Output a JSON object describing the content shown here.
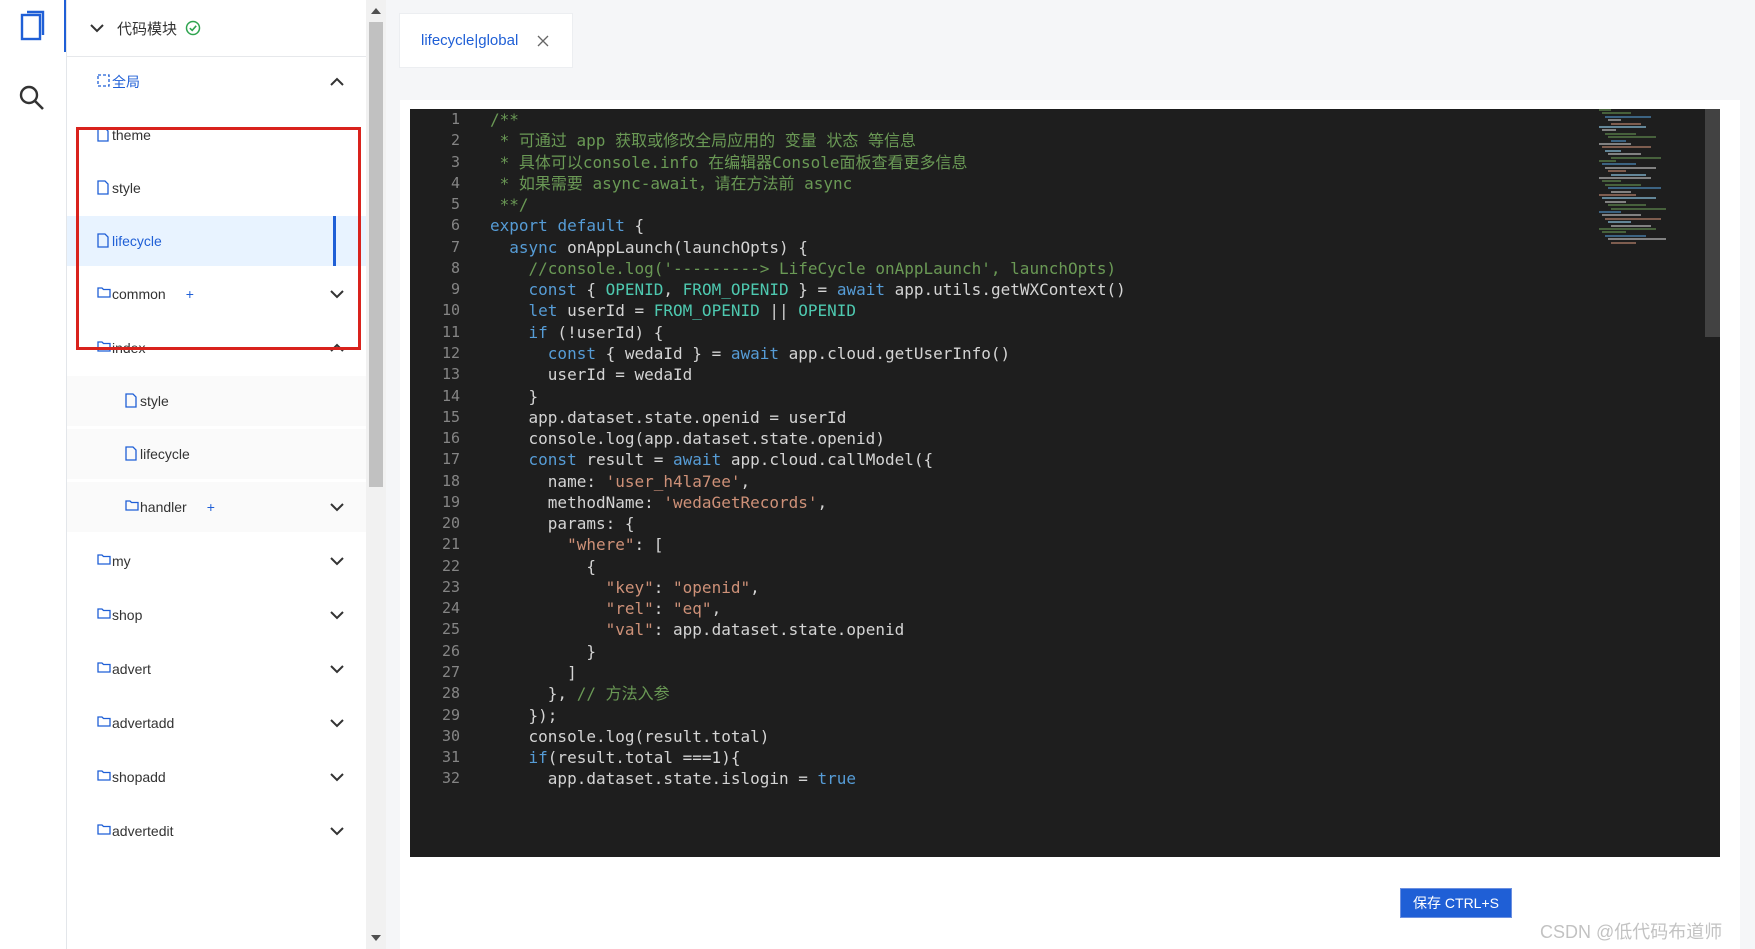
{
  "activity": {
    "icons": [
      "files-icon",
      "search-icon"
    ]
  },
  "sidebar": {
    "header_title": "代码模块",
    "items": [
      {
        "label": "全局",
        "kind": "global",
        "expanded": true
      },
      {
        "label": "theme",
        "kind": "file"
      },
      {
        "label": "style",
        "kind": "file"
      },
      {
        "label": "lifecycle",
        "kind": "file",
        "selected": true
      },
      {
        "label": "common",
        "kind": "folder",
        "plus": "+"
      },
      {
        "label": "index",
        "kind": "folder",
        "expanded": true
      },
      {
        "label": "style",
        "kind": "file"
      },
      {
        "label": "lifecycle",
        "kind": "file"
      },
      {
        "label": "handler",
        "kind": "folder",
        "plus": "+"
      },
      {
        "label": "my",
        "kind": "folder"
      },
      {
        "label": "shop",
        "kind": "folder"
      },
      {
        "label": "advert",
        "kind": "folder"
      },
      {
        "label": "advertadd",
        "kind": "folder"
      },
      {
        "label": "shopadd",
        "kind": "folder"
      },
      {
        "label": "advertedit",
        "kind": "folder"
      }
    ]
  },
  "tabs": [
    {
      "label": "lifecycle|global",
      "close": "X"
    }
  ],
  "editor": {
    "line_numbers": [
      "1",
      "2",
      "3",
      "4",
      "5",
      "6",
      "7",
      "8",
      "9",
      "10",
      "11",
      "12",
      "13",
      "14",
      "15",
      "16",
      "17",
      "18",
      "19",
      "20",
      "21",
      "22",
      "23",
      "24",
      "25",
      "26",
      "27",
      "28",
      "29",
      "30",
      "31",
      "32"
    ],
    "lines": [
      "/**",
      " * 可通过 app 获取或修改全局应用的 变量 状态 等信息",
      " * 具体可以console.info 在编辑器Console面板查看更多信息",
      " * 如果需要 async-await，请在方法前 async",
      " **/",
      "export default {",
      "  async onAppLaunch(launchOpts) {",
      "    //console.log('---------> LifeCycle onAppLaunch', launchOpts)",
      "    const { OPENID, FROM_OPENID } = await app.utils.getWXContext()",
      "    let userId = FROM_OPENID || OPENID",
      "    if (!userId) {",
      "      const { wedaId } = await app.cloud.getUserInfo()",
      "      userId = wedaId",
      "    }",
      "    app.dataset.state.openid = userId",
      "    console.log(app.dataset.state.openid)",
      "    const result = await app.cloud.callModel({",
      "      name: 'user_h4la7ee',",
      "      methodName: 'wedaGetRecords',",
      "      params: {",
      "        \"where\": [",
      "          {",
      "            \"key\": \"openid\",",
      "            \"rel\": \"eq\",",
      "            \"val\": app.dataset.state.openid",
      "          }",
      "        ]",
      "      }, // 方法入参",
      "    });",
      "    console.log(result.total)",
      "    if(result.total ===1){",
      "      app.dataset.state.islogin = true"
    ]
  },
  "save_button": "保存 CTRL+S",
  "watermark": "CSDN @低代码布道师",
  "colors": {
    "accent": "#1f5fd6",
    "editor_bg": "#1e1e1e",
    "highlight_border": "#d9221c",
    "selected_bg": "#e8f3ff"
  }
}
